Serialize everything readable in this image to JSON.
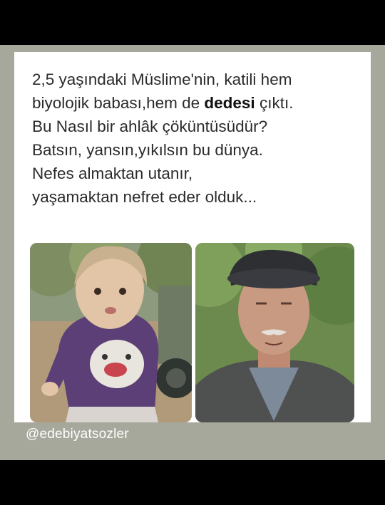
{
  "post": {
    "line1": "2,5 yaşındaki Müslime'nin, katili hem",
    "line2_pre": "biyolojik babası,hem de ",
    "line2_bold": "dedesi",
    "line2_post": " çıktı.",
    "line3": "Bu Nasıl bir ahlâk çöküntüsüdür?",
    "line4": "Batsın, yansın,yıkılsın bu dünya.",
    "line5": "Nefes almaktan utanır,",
    "line6": "yaşamaktan nefret eder olduk..."
  },
  "watermark": "@edebiyatsozler"
}
